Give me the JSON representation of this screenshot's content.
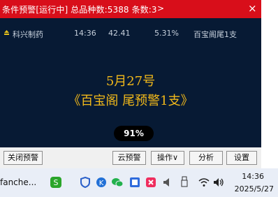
{
  "window": {
    "title": "条件预警[运行中] 总品种数:5388 条数:3",
    "title_arrow": ">",
    "close_glyph": "×"
  },
  "alert_row": {
    "name": "科兴制药",
    "time": "14:36",
    "price": "42.41",
    "change": "5.31%",
    "condition": "百宝阁尾1支"
  },
  "announcement": {
    "line1": "5月27号",
    "line2": "《百宝阁 尾预警1支》"
  },
  "progress": {
    "value": 0.91,
    "text": "91%"
  },
  "buttons": {
    "close_alert": "关闭预警",
    "cloud_alert": "云预警",
    "operate": "操作∨",
    "analyze": "分析",
    "settings": "设置"
  },
  "taskbar": {
    "app_label": "fanche...",
    "time": "14:36",
    "date": "2025/5/27",
    "icons": [
      "sogou-icon",
      "shield-icon",
      "k-icon",
      "wechat-icon",
      "app-icon-1",
      "app-icon-2",
      "speaker-icon",
      "usb-icon",
      "wifi-icon",
      "volume-icon"
    ]
  },
  "colors": {
    "titlebar": "#d80e1a",
    "panel": "#071a34",
    "announce": "#f2b91a",
    "row_text": "#c6d0dc"
  }
}
